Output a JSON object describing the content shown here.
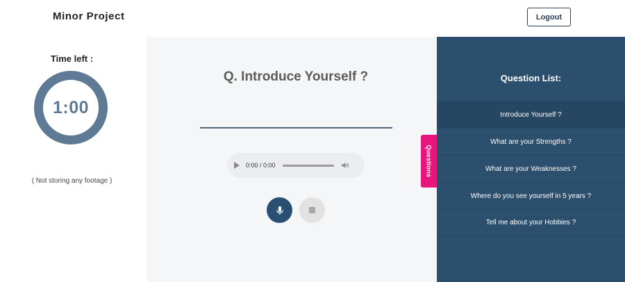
{
  "header": {
    "brand": "Minor Project",
    "logout_label": "Logout"
  },
  "timer": {
    "label": "Time left :",
    "value": "1:00",
    "note": "( Not storing any footage )",
    "ring_color": "#5f7a94"
  },
  "main": {
    "question": "Q. Introduce Yourself ?",
    "audio": {
      "time": "0:00 / 0:00",
      "progress": 0
    },
    "mic_icon": "microphone-icon",
    "stop_icon": "stop-icon"
  },
  "side_tab": {
    "label": "Questions",
    "color": "#e8157e"
  },
  "question_list": {
    "title": "Question List:",
    "items": [
      {
        "label": "Introduce Yourself ?",
        "active": true
      },
      {
        "label": "What are your Strengths ?",
        "active": false
      },
      {
        "label": "What are your Weaknesses ?",
        "active": false
      },
      {
        "label": "Where do you see yourself in 5 years ?",
        "active": false
      },
      {
        "label": "Tell me about your Hobbies ?",
        "active": false
      }
    ],
    "panel_color": "#2c4f6e"
  }
}
